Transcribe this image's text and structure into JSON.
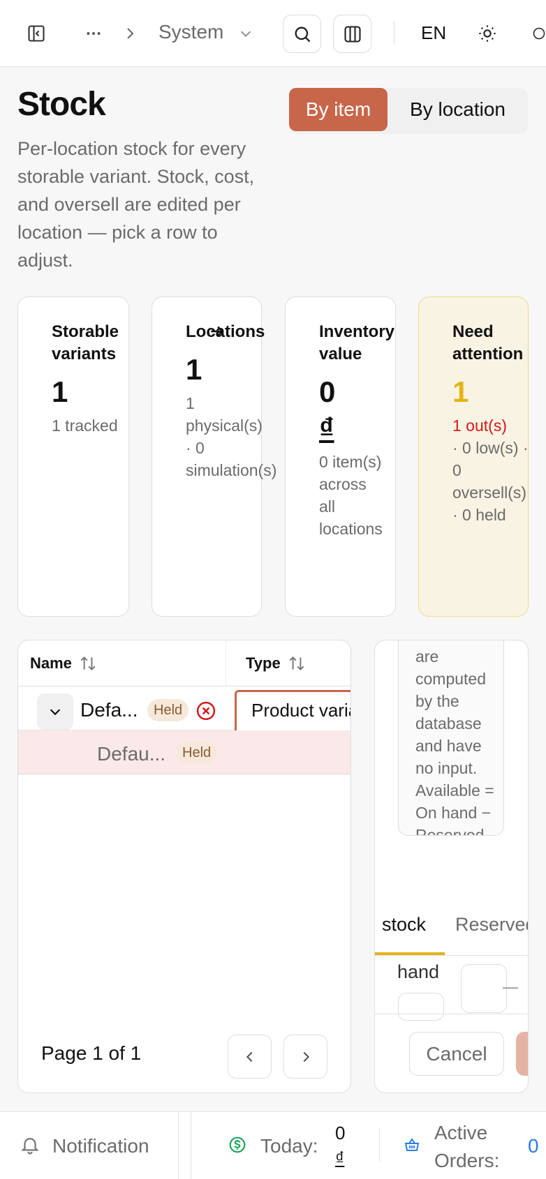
{
  "topbar": {
    "breadcrumb_current": "System",
    "language": "EN"
  },
  "header": {
    "title": "Stock",
    "subtitle": "Per-location stock for every storable variant. Stock, cost, and oversell are edited per location — pick a row to adjust.",
    "view_toggle": {
      "by_item": "By item",
      "by_location": "By location",
      "selected": "By item"
    }
  },
  "stats": [
    {
      "label": "Storable variants",
      "value": "1",
      "sub": "1 tracked"
    },
    {
      "label": "Locations",
      "value": "1",
      "sub": "1 physical(s) · 0 simulation(s)"
    },
    {
      "label": "Inventory value",
      "value": "0",
      "currency": "₫",
      "sub": "0 item(s) across all locations"
    },
    {
      "label": "Need attention",
      "value": "1",
      "sub_alert": "1 out(s)",
      "sub": "· 0 low(s) · 0 oversell(s) · 0 held"
    }
  ],
  "table": {
    "columns": [
      "Name",
      "Type"
    ],
    "rows": [
      {
        "name": "Defa...",
        "badge": "Held",
        "type": "Product variant"
      },
      {
        "name": "Defau...",
        "badge": "Held"
      }
    ],
    "pagination": "Page 1 of 1"
  },
  "detail": {
    "help_text": "are computed by the database and have no input. Available = On hand − Reserved.",
    "tabs": [
      "stock",
      "Reserved"
    ],
    "active_tab": "stock",
    "field_label": "hand",
    "cancel_label": "Cancel"
  },
  "bottombar": {
    "notification_label": "Notification",
    "today_label": "Today:",
    "today_value": "0",
    "today_currency": "₫",
    "active_orders_label": "Active Orders:",
    "active_orders_value": "0"
  },
  "colors": {
    "accent": "#c8664a",
    "warning": "#e2b416",
    "danger": "#d11a1a",
    "link": "#2b7de9"
  }
}
